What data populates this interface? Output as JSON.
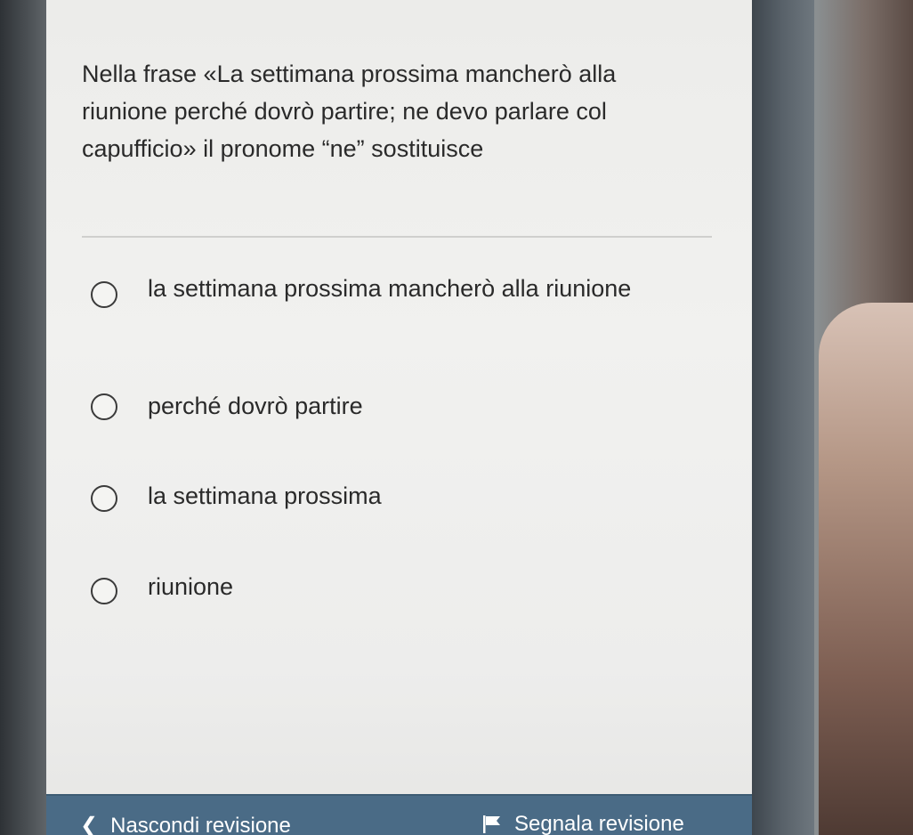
{
  "question": {
    "text": "Nella frase «La settimana prossima mancherò alla riunione perché dovrò partire; ne devo parlare col capufficio» il pronome “ne” sostituisce"
  },
  "options": [
    {
      "label": "la settimana prossima mancherò alla riunione"
    },
    {
      "label": "perché dovrò partire"
    },
    {
      "label": "la settimana prossima"
    },
    {
      "label": "riunione"
    }
  ],
  "bottom_bar": {
    "hide_label": "Nascondi revisione",
    "report_label": "Segnala revisione",
    "hide_icon": "chevron-left-icon",
    "report_icon": "flag-icon"
  },
  "colors": {
    "bottom_bar": "#4a6b86",
    "screen_bg": "#efefed",
    "text": "#2a2a2a"
  }
}
